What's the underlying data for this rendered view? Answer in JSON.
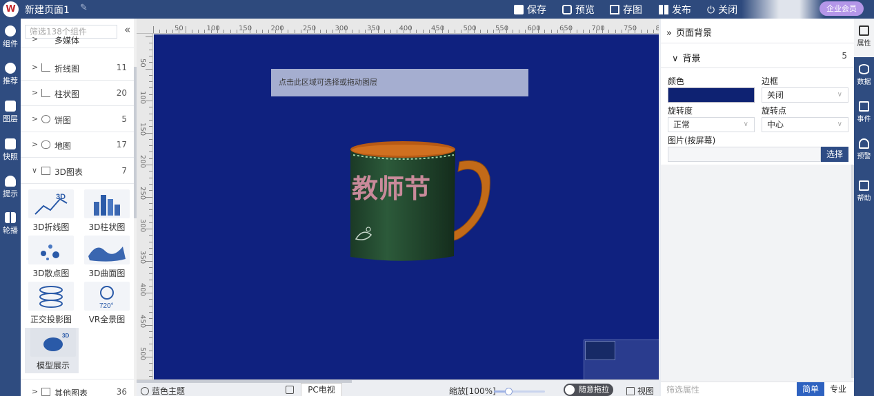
{
  "topbar": {
    "logo_glyph": "W",
    "page_title": "新建页面1",
    "save": "保存",
    "preview": "预览",
    "saveas": "存图",
    "publish": "发布",
    "close": "关闭",
    "vip": "企业会员"
  },
  "leftrail": {
    "items": [
      "组件",
      "推荐",
      "图层",
      "快照",
      "提示",
      "轮播"
    ]
  },
  "panel": {
    "search_placeholder": "筛选138个组件",
    "collapse_glyph": "«",
    "partial_top": "多媒体",
    "categories": [
      {
        "label": "折线图",
        "count": "11"
      },
      {
        "label": "柱状图",
        "count": "20"
      },
      {
        "label": "饼图",
        "count": "5"
      },
      {
        "label": "地图",
        "count": "17"
      },
      {
        "label": "3D图表",
        "count": "7"
      }
    ],
    "tiles": [
      "3D折线图",
      "3D柱状图",
      "3D散点图",
      "3D曲面图",
      "正交投影图",
      "VR全景图",
      "模型展示"
    ],
    "bottom_category": {
      "label": "其他图表",
      "count": "36"
    }
  },
  "ruler": {
    "h_marks": [
      "50",
      "100",
      "150",
      "200",
      "250",
      "300",
      "350",
      "400",
      "450",
      "500",
      "550",
      "600",
      "650",
      "700",
      "750",
      "8"
    ],
    "v_marks": [
      "50",
      "100",
      "150",
      "200",
      "250",
      "300",
      "350",
      "400",
      "450",
      "500"
    ]
  },
  "canvas": {
    "hint": "点击此区域可选择或拖动图层",
    "mug_text": "教师节",
    "background_color": "#0f217f"
  },
  "bottombar": {
    "theme": "蓝色主题",
    "device": "PC电视",
    "zoom": "缩放[100%]",
    "drag_toggle": "随意拖拉",
    "view": "视图"
  },
  "props": {
    "header": "页面背景",
    "section": "背景",
    "section_count": "5",
    "color_label": "颜色",
    "color_value": "#0e2272",
    "border_label": "边框",
    "border_value": "关闭",
    "rotate_label": "旋转度",
    "rotate_value": "正常",
    "pivot_label": "旋转点",
    "pivot_value": "中心",
    "image_label": "图片(按屏幕)",
    "pick_button": "选择",
    "filter_placeholder": "筛选属性",
    "simple": "简单",
    "pro": "专业"
  },
  "rightrail": {
    "items": [
      "属性",
      "数据",
      "事件",
      "预警",
      "帮助"
    ]
  }
}
